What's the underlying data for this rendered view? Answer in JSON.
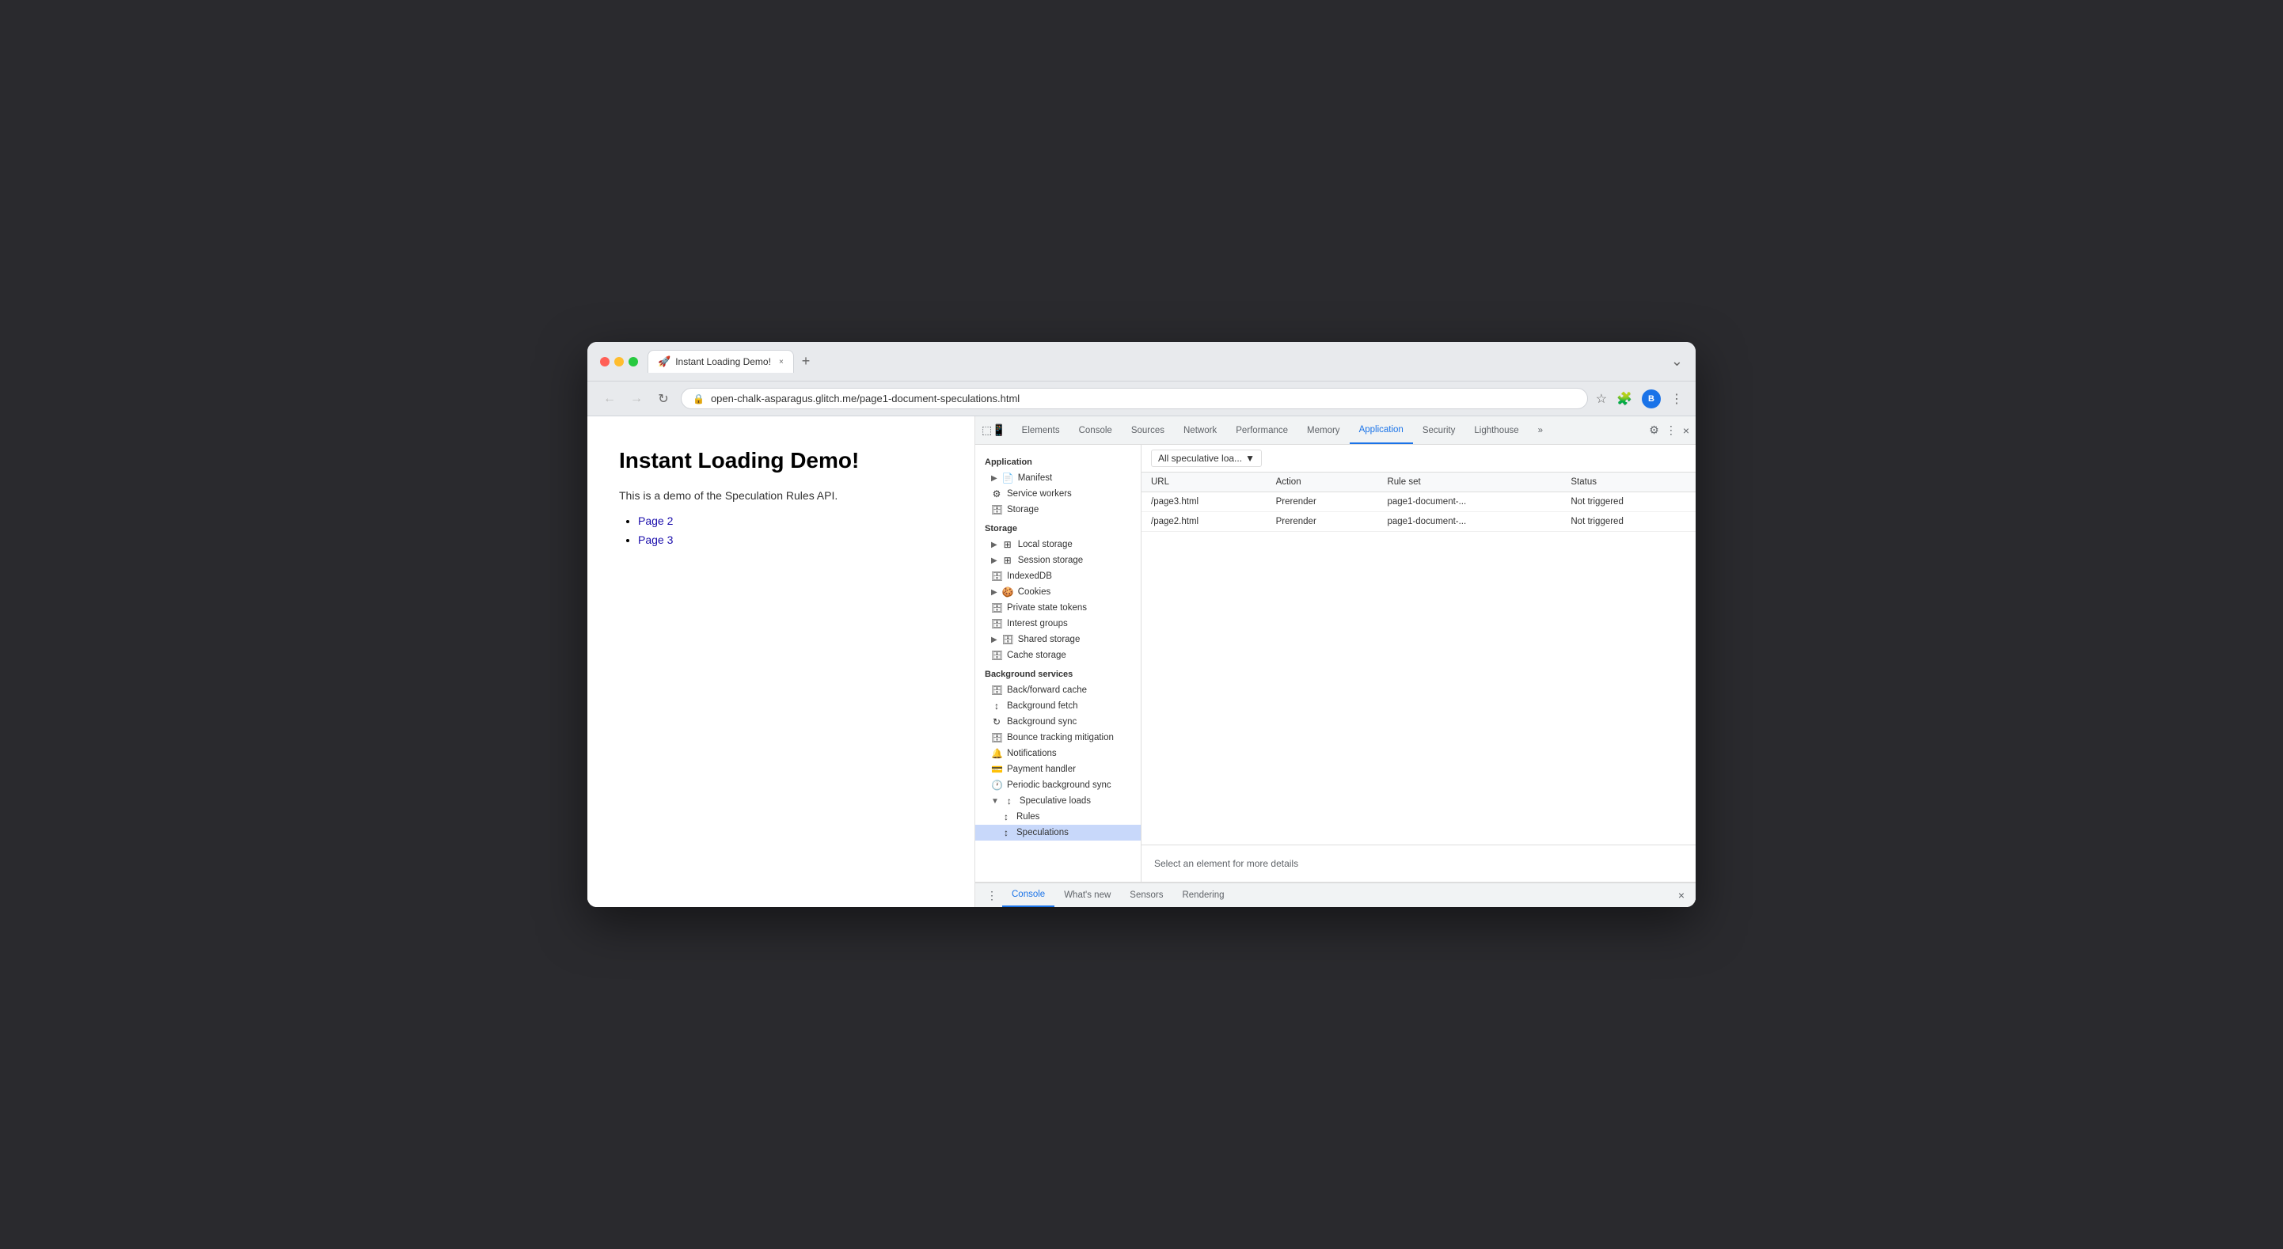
{
  "browser": {
    "traffic_lights": [
      "red",
      "yellow",
      "green"
    ],
    "tab": {
      "icon": "🚀",
      "title": "Instant Loading Demo!",
      "close": "×"
    },
    "tab_new": "+",
    "more_icon": "⌄",
    "nav": {
      "back": "←",
      "forward": "→",
      "refresh": "↻"
    },
    "address": {
      "lock_icon": "⊕",
      "url": "open-chalk-asparagus.glitch.me/page1-document-speculations.html"
    },
    "address_right": {
      "star": "☆",
      "extension": "🧩",
      "profile": "B",
      "menu": "⋮"
    }
  },
  "page": {
    "title": "Instant Loading Demo!",
    "description": "This is a demo of the Speculation Rules API.",
    "links": [
      {
        "text": "Page 2",
        "href": "#"
      },
      {
        "text": "Page 3",
        "href": "#"
      }
    ]
  },
  "devtools": {
    "tabs": [
      {
        "id": "elements",
        "label": "Elements",
        "active": false
      },
      {
        "id": "console",
        "label": "Console",
        "active": false
      },
      {
        "id": "sources",
        "label": "Sources",
        "active": false
      },
      {
        "id": "network",
        "label": "Network",
        "active": false
      },
      {
        "id": "performance",
        "label": "Performance",
        "active": false
      },
      {
        "id": "memory",
        "label": "Memory",
        "active": false
      },
      {
        "id": "application",
        "label": "Application",
        "active": true
      },
      {
        "id": "security",
        "label": "Security",
        "active": false
      },
      {
        "id": "lighthouse",
        "label": "Lighthouse",
        "active": false
      },
      {
        "id": "more",
        "label": "»",
        "active": false
      }
    ],
    "header_icons": {
      "settings": "⚙",
      "menu": "⋮",
      "close": "×",
      "inspect": "⬚",
      "device": "📱"
    },
    "sidebar": {
      "sections": [
        {
          "id": "application",
          "label": "Application",
          "items": [
            {
              "id": "manifest",
              "label": "Manifest",
              "icon": "📄",
              "toggle": "▶",
              "indent": 1
            },
            {
              "id": "service-workers",
              "label": "Service workers",
              "icon": "⚙",
              "indent": 1
            },
            {
              "id": "storage",
              "label": "Storage",
              "icon": "🗄",
              "indent": 1
            }
          ]
        },
        {
          "id": "storage",
          "label": "Storage",
          "items": [
            {
              "id": "local-storage",
              "label": "Local storage",
              "icon": "⊞",
              "toggle": "▶",
              "indent": 1
            },
            {
              "id": "session-storage",
              "label": "Session storage",
              "icon": "⊞",
              "toggle": "▶",
              "indent": 1
            },
            {
              "id": "indexeddb",
              "label": "IndexedDB",
              "icon": "🗄",
              "indent": 1
            },
            {
              "id": "cookies",
              "label": "Cookies",
              "icon": "🍪",
              "toggle": "▶",
              "indent": 1
            },
            {
              "id": "private-state-tokens",
              "label": "Private state tokens",
              "icon": "🗄",
              "indent": 1
            },
            {
              "id": "interest-groups",
              "label": "Interest groups",
              "icon": "🗄",
              "indent": 1
            },
            {
              "id": "shared-storage",
              "label": "Shared storage",
              "icon": "🗄",
              "toggle": "▶",
              "indent": 1
            },
            {
              "id": "cache-storage",
              "label": "Cache storage",
              "icon": "🗄",
              "indent": 1
            }
          ]
        },
        {
          "id": "background-services",
          "label": "Background services",
          "items": [
            {
              "id": "back-forward-cache",
              "label": "Back/forward cache",
              "icon": "🗄",
              "indent": 1
            },
            {
              "id": "background-fetch",
              "label": "Background fetch",
              "icon": "↕",
              "indent": 1
            },
            {
              "id": "background-sync",
              "label": "Background sync",
              "icon": "↻",
              "indent": 1
            },
            {
              "id": "bounce-tracking",
              "label": "Bounce tracking mitigation",
              "icon": "🗄",
              "indent": 1
            },
            {
              "id": "notifications",
              "label": "Notifications",
              "icon": "🔔",
              "indent": 1
            },
            {
              "id": "payment-handler",
              "label": "Payment handler",
              "icon": "💳",
              "indent": 1
            },
            {
              "id": "periodic-background-sync",
              "label": "Periodic background sync",
              "icon": "🕐",
              "indent": 1
            },
            {
              "id": "speculative-loads",
              "label": "Speculative loads",
              "icon": "↕",
              "toggle": "▼",
              "indent": 1
            },
            {
              "id": "rules",
              "label": "Rules",
              "icon": "↕",
              "indent": 2
            },
            {
              "id": "speculations",
              "label": "Speculations",
              "icon": "↕",
              "indent": 2,
              "active": true
            }
          ]
        }
      ]
    },
    "panel": {
      "dropdown_label": "All speculative loa...",
      "table": {
        "columns": [
          "URL",
          "Action",
          "Rule set",
          "Status"
        ],
        "rows": [
          {
            "url": "/page3.html",
            "action": "Prerender",
            "rule_set": "page1-document-...",
            "status": "Not triggered"
          },
          {
            "url": "/page2.html",
            "action": "Prerender",
            "rule_set": "page1-document-...",
            "status": "Not triggered"
          }
        ]
      },
      "details_text": "Select an element for more details"
    },
    "bottom_bar": {
      "menu_icon": "⋮",
      "tabs": [
        {
          "id": "console",
          "label": "Console",
          "active": true
        },
        {
          "id": "whats-new",
          "label": "What's new",
          "active": false
        },
        {
          "id": "sensors",
          "label": "Sensors",
          "active": false
        },
        {
          "id": "rendering",
          "label": "Rendering",
          "active": false
        }
      ],
      "close": "×"
    }
  }
}
